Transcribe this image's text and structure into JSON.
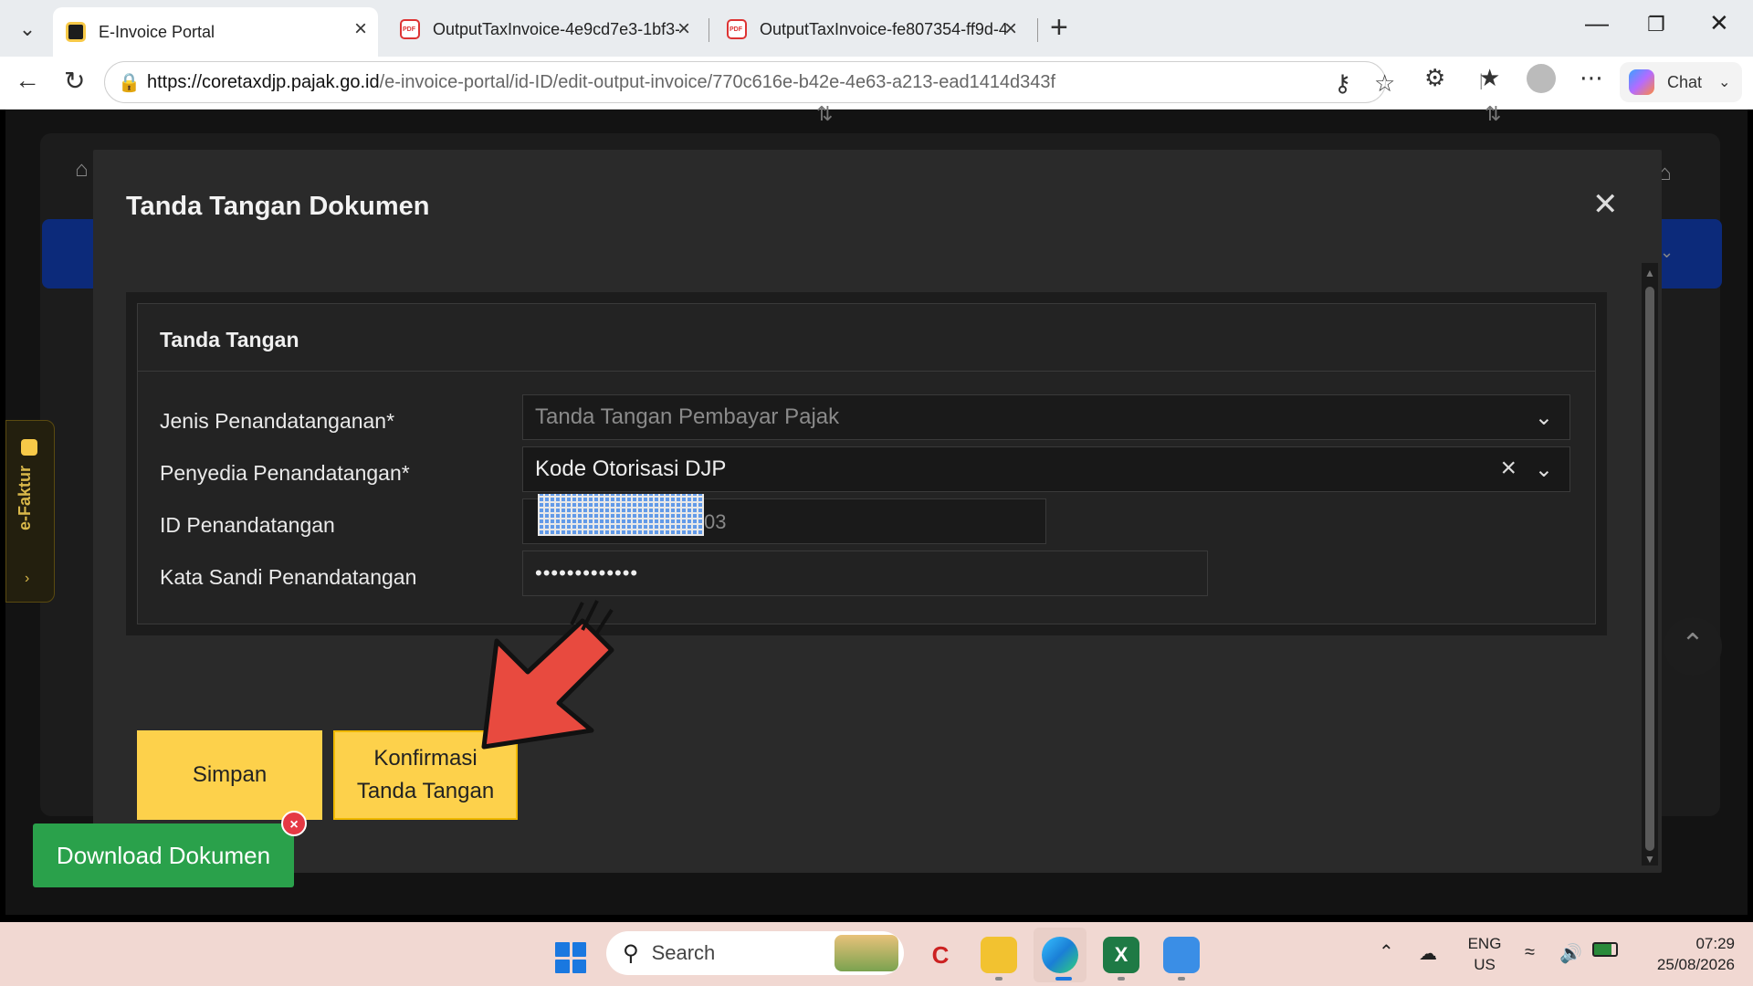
{
  "browser": {
    "tabs": [
      {
        "title": "E-Invoice Portal",
        "active": true
      },
      {
        "title": "OutputTaxInvoice-4e9cd7e3-1bf3-",
        "active": false
      },
      {
        "title": "OutputTaxInvoice-fe807354-ff9d-4",
        "active": false
      }
    ],
    "url_host": "https://coretaxdjp.pajak.go.id",
    "url_path": "/e-invoice-portal/id-ID/edit-output-invoice/770c616e-b42e-4e63-a213-ead1414d343f",
    "chat_label": "Chat"
  },
  "sidebar": {
    "tab_label": "e-Faktur"
  },
  "modal": {
    "title": "Tanda Tangan Dokumen",
    "section_title": "Tanda Tangan",
    "fields": [
      {
        "label": "Jenis Penandatanganan*",
        "value": "Tanda Tangan Pembayar Pajak"
      },
      {
        "label": "Penyedia Penandatangan*",
        "value": "Kode Otorisasi DJP"
      },
      {
        "label": "ID Penandatangan",
        "value_tail": "03"
      },
      {
        "label": "Kata Sandi Penandatangan",
        "value": "•••••••••••••"
      }
    ],
    "buttons": {
      "save": "Simpan",
      "confirm_line1": "Konfirmasi",
      "confirm_line2": "Tanda Tangan"
    }
  },
  "toast": {
    "download_label": "Download Dokumen",
    "badge_icon": "close-icon"
  },
  "taskbar": {
    "search_placeholder": "Search",
    "lang_line1": "ENG",
    "lang_line2": "US",
    "time": "07:29",
    "date": "25/08/2026"
  },
  "colors": {
    "accent_yellow": "#fdd14b",
    "download_green": "#2aa14b",
    "arrow_red": "#e84a3f"
  }
}
